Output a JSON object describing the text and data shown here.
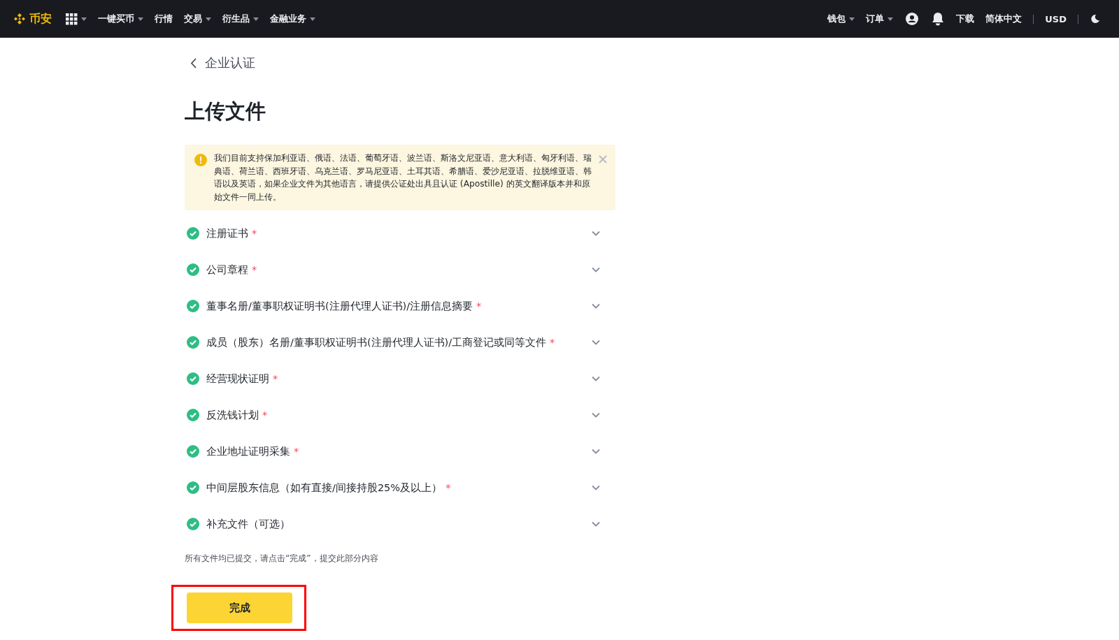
{
  "header": {
    "logo_text": "币安",
    "nav": [
      {
        "kind": "apps",
        "dropdown": true
      },
      {
        "kind": "text",
        "label": "一键买币",
        "dropdown": true
      },
      {
        "kind": "text",
        "label": "行情",
        "dropdown": false
      },
      {
        "kind": "text",
        "label": "交易",
        "dropdown": true
      },
      {
        "kind": "text",
        "label": "衍生品",
        "dropdown": true
      },
      {
        "kind": "text",
        "label": "金融业务",
        "dropdown": true
      }
    ],
    "right": [
      {
        "kind": "text",
        "label": "钱包",
        "dropdown": true
      },
      {
        "kind": "text",
        "label": "订单",
        "dropdown": true
      },
      {
        "kind": "user"
      },
      {
        "kind": "bell"
      },
      {
        "kind": "text",
        "label": "下载",
        "dropdown": false
      },
      {
        "kind": "text",
        "label": "简体中文",
        "dropdown": false
      },
      {
        "kind": "divider"
      },
      {
        "kind": "text",
        "label": "USD",
        "dropdown": false
      },
      {
        "kind": "divider"
      },
      {
        "kind": "moon"
      }
    ]
  },
  "back_link": "企业认证",
  "title": "上传文件",
  "notice": {
    "text": "我们目前支持保加利亚语、俄语、法语、葡萄牙语、波兰语、斯洛文尼亚语、意大利语、匈牙利语、瑞典语、荷兰语、西班牙语、乌克兰语、罗马尼亚语、土耳其语、希腊语、爱沙尼亚语、拉脱维亚语、韩语以及英语，如果企业文件为其他语言，请提供公证处出具且认证 (Apostille) 的英文翻译版本并和原始文件一同上传。"
  },
  "documents": [
    {
      "label": "注册证书",
      "required_mark": "*",
      "completed": true,
      "expanded": false
    },
    {
      "label": "公司章程",
      "required_mark": "*",
      "completed": true,
      "expanded": false
    },
    {
      "label": "董事名册/董事职权证明书(注册代理人证书)/注册信息摘要",
      "required_mark": "*",
      "completed": true,
      "expanded": false
    },
    {
      "label": "成员（股东）名册/董事职权证明书(注册代理人证书)/工商登记或同等文件",
      "required_mark": "*",
      "completed": true,
      "expanded": false
    },
    {
      "label": "经营现状证明",
      "required_mark": "*",
      "completed": true,
      "expanded": false
    },
    {
      "label": "反洗钱计划",
      "required_mark": "*",
      "completed": true,
      "expanded": false
    },
    {
      "label": "企业地址证明采集",
      "required_mark": "*",
      "completed": true,
      "expanded": false
    },
    {
      "label": "中间层股东信息（如有直接/间接持股25%及以上）",
      "required_mark": "*",
      "completed": true,
      "expanded": false
    },
    {
      "label": "补充文件（可选）",
      "completed": true,
      "expanded": false
    }
  ],
  "hint": "所有文件均已提交，请点击“完成”，提交此部分内容",
  "done_button": {
    "label": "完成",
    "highlighted": true
  }
}
